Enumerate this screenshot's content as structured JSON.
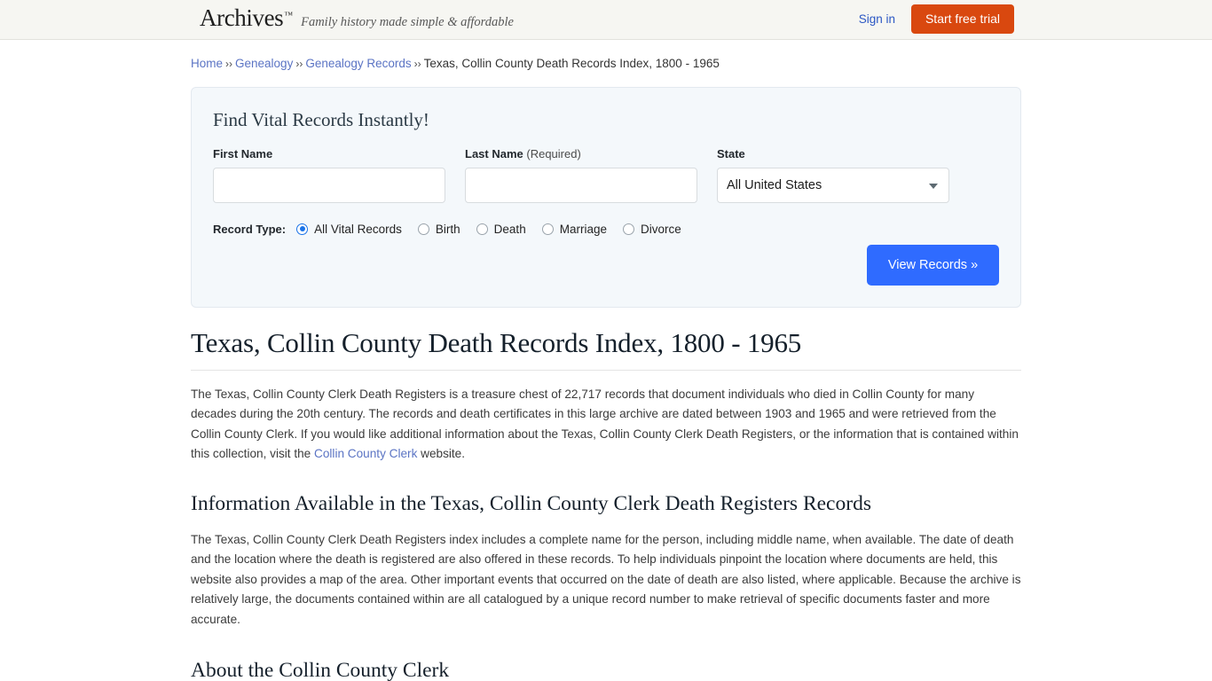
{
  "header": {
    "brand_name": "Archives",
    "brand_tm": "™",
    "tagline": "Family history made simple & affordable",
    "signin_label": "Sign in",
    "trial_label": "Start free trial",
    "background_color": "#f6f6f2",
    "trial_button_color": "#d9480f",
    "link_color": "#2b57c4"
  },
  "breadcrumb": {
    "separator": "››",
    "items": [
      {
        "label": "Home",
        "is_link": true
      },
      {
        "label": "Genealogy",
        "is_link": true
      },
      {
        "label": "Genealogy Records",
        "is_link": true
      },
      {
        "label": "Texas, Collin County Death Records Index, 1800 - 1965",
        "is_link": false
      }
    ]
  },
  "search_panel": {
    "title": "Find Vital Records Instantly!",
    "first_name": {
      "label": "First Name",
      "value": "",
      "placeholder": ""
    },
    "last_name": {
      "label": "Last Name",
      "required_note": "(Required)",
      "value": "",
      "placeholder": ""
    },
    "state": {
      "label": "State",
      "selected": "All United States"
    },
    "record_type": {
      "label": "Record Type:",
      "options": [
        {
          "label": "All Vital Records",
          "checked": true
        },
        {
          "label": "Birth",
          "checked": false
        },
        {
          "label": "Death",
          "checked": false
        },
        {
          "label": "Marriage",
          "checked": false
        },
        {
          "label": "Divorce",
          "checked": false
        }
      ]
    },
    "submit_label": "View Records »",
    "submit_color": "#2f6bff",
    "background_color": "#f4f8fb"
  },
  "article": {
    "title": "Texas, Collin County Death Records Index, 1800 - 1965",
    "paragraph_1_part_1": "The Texas, Collin County Clerk Death Registers is a treasure chest of 22,717 records that document individuals who died in Collin County for many decades during the 20th century. The records and death certificates in this large archive are dated between 1903 and 1965 and were retrieved from the Collin County Clerk. If you would like additional information about the Texas, Collin County Clerk Death Registers, or the information that is contained within this collection, visit the ",
    "paragraph_1_link": "Collin County Clerk",
    "paragraph_1_part_2": " website.",
    "section_2_title": "Information Available in the Texas, Collin County Clerk Death Registers Records",
    "paragraph_2": "The Texas, Collin County Clerk Death Registers index includes a complete name for the person, including middle name, when available. The date of death and the location where the death is registered are also offered in these records. To help individuals pinpoint the location where documents are held, this website also provides a map of the area. Other important events that occurred on the date of death are also listed, where applicable. Because the archive is relatively large, the documents contained within are all catalogued by a unique record number to make retrieval of specific documents faster and more accurate.",
    "section_3_title": "About the Collin County Clerk"
  }
}
